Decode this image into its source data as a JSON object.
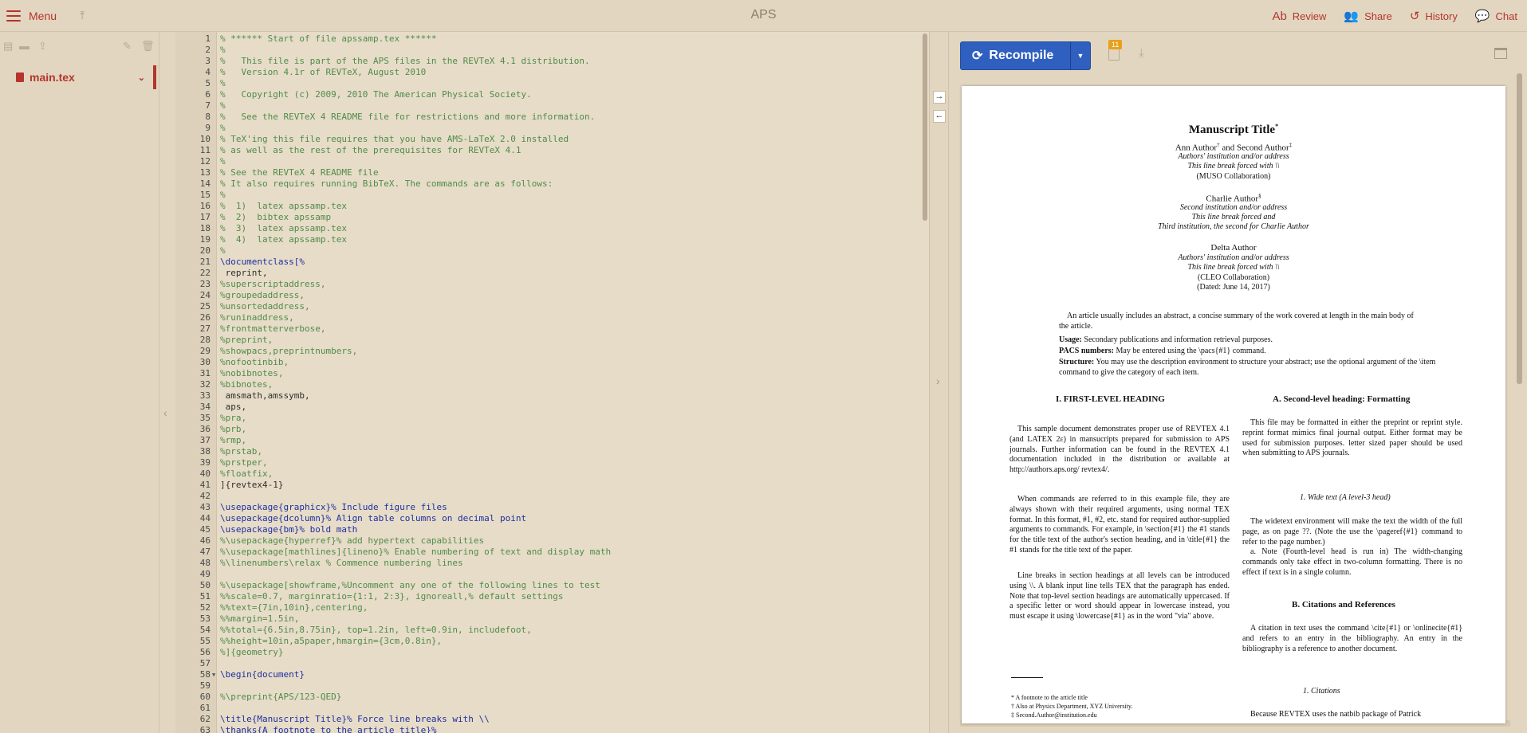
{
  "topbar": {
    "menu_label": "Menu",
    "title": "APS",
    "actions": [
      {
        "label": "Review",
        "icon": "review-icon"
      },
      {
        "label": "Share",
        "icon": "share-icon"
      },
      {
        "label": "History",
        "icon": "history-icon"
      },
      {
        "label": "Chat",
        "icon": "chat-icon"
      }
    ]
  },
  "file_tree": {
    "main_file": "main.tex"
  },
  "colors": {
    "accent": "#b5342d",
    "recompile": "#2f5fbf",
    "badge": "#e8a11b",
    "comment": "#4f8c4a",
    "command": "#1e2fa0"
  },
  "editor": {
    "lines": [
      [
        1,
        "% ****** Start of file apssamp.tex ******",
        "c"
      ],
      [
        2,
        "%",
        "c"
      ],
      [
        3,
        "%   This file is part of the APS files in the REVTeX 4.1 distribution.",
        "c"
      ],
      [
        4,
        "%   Version 4.1r of REVTeX, August 2010",
        "c"
      ],
      [
        5,
        "%",
        "c"
      ],
      [
        6,
        "%   Copyright (c) 2009, 2010 The American Physical Society.",
        "c"
      ],
      [
        7,
        "%",
        "c"
      ],
      [
        8,
        "%   See the REVTeX 4 README file for restrictions and more information.",
        "c"
      ],
      [
        9,
        "%",
        "c"
      ],
      [
        10,
        "% TeX'ing this file requires that you have AMS-LaTeX 2.0 installed",
        "c"
      ],
      [
        11,
        "% as well as the rest of the prerequisites for REVTeX 4.1",
        "c"
      ],
      [
        12,
        "%",
        "c"
      ],
      [
        13,
        "% See the REVTeX 4 README file",
        "c"
      ],
      [
        14,
        "% It also requires running BibTeX. The commands are as follows:",
        "c"
      ],
      [
        15,
        "%",
        "c"
      ],
      [
        16,
        "%  1)  latex apssamp.tex",
        "c"
      ],
      [
        17,
        "%  2)  bibtex apssamp",
        "c"
      ],
      [
        18,
        "%  3)  latex apssamp.tex",
        "c"
      ],
      [
        19,
        "%  4)  latex apssamp.tex",
        "c"
      ],
      [
        20,
        "%",
        "c"
      ],
      [
        21,
        "\\documentclass[%",
        "k"
      ],
      [
        22,
        " reprint,",
        "n"
      ],
      [
        23,
        "%superscriptaddress,",
        "c"
      ],
      [
        24,
        "%groupedaddress,",
        "c"
      ],
      [
        25,
        "%unsortedaddress,",
        "c"
      ],
      [
        26,
        "%runinaddress,",
        "c"
      ],
      [
        27,
        "%frontmatterverbose,",
        "c"
      ],
      [
        28,
        "%preprint,",
        "c"
      ],
      [
        29,
        "%showpacs,preprintnumbers,",
        "c"
      ],
      [
        30,
        "%nofootinbib,",
        "c"
      ],
      [
        31,
        "%nobibnotes,",
        "c"
      ],
      [
        32,
        "%bibnotes,",
        "c"
      ],
      [
        33,
        " amsmath,amssymb,",
        "n"
      ],
      [
        34,
        " aps,",
        "n"
      ],
      [
        35,
        "%pra,",
        "c"
      ],
      [
        36,
        "%prb,",
        "c"
      ],
      [
        37,
        "%rmp,",
        "c"
      ],
      [
        38,
        "%prstab,",
        "c"
      ],
      [
        39,
        "%prstper,",
        "c"
      ],
      [
        40,
        "%floatfix,",
        "c"
      ],
      [
        41,
        "]{revtex4-1}",
        "n"
      ],
      [
        42,
        "",
        "n"
      ],
      [
        43,
        "\\usepackage{graphicx}% Include figure files",
        "k"
      ],
      [
        44,
        "\\usepackage{dcolumn}% Align table columns on decimal point",
        "k"
      ],
      [
        45,
        "\\usepackage{bm}% bold math",
        "k"
      ],
      [
        46,
        "%\\usepackage{hyperref}% add hypertext capabilities",
        "c"
      ],
      [
        47,
        "%\\usepackage[mathlines]{lineno}% Enable numbering of text and display math",
        "c"
      ],
      [
        48,
        "%\\linenumbers\\relax % Commence numbering lines",
        "c"
      ],
      [
        49,
        "",
        "n"
      ],
      [
        50,
        "%\\usepackage[showframe,%Uncomment any one of the following lines to test",
        "c"
      ],
      [
        51,
        "%%scale=0.7, marginratio={1:1, 2:3}, ignoreall,% default settings",
        "c"
      ],
      [
        52,
        "%%text={7in,10in},centering,",
        "c"
      ],
      [
        53,
        "%%margin=1.5in,",
        "c"
      ],
      [
        54,
        "%%total={6.5in,8.75in}, top=1.2in, left=0.9in, includefoot,",
        "c"
      ],
      [
        55,
        "%%height=10in,a5paper,hmargin={3cm,0.8in},",
        "c"
      ],
      [
        56,
        "%]{geometry}",
        "c"
      ],
      [
        57,
        "",
        "n"
      ],
      [
        58,
        "\\begin{document}",
        "k"
      ],
      [
        59,
        "",
        "n"
      ],
      [
        60,
        "%\\preprint{APS/123-QED}",
        "c"
      ],
      [
        61,
        "",
        "n"
      ],
      [
        62,
        "\\title{Manuscript Title}% Force line breaks with \\\\",
        "k"
      ],
      [
        63,
        "\\thanks{A footnote to the article title}%",
        "k"
      ]
    ]
  },
  "pdf": {
    "recompile_label": "Recompile",
    "log_badge": "11",
    "page": {
      "title": "Manuscript Title",
      "title_mark": "*",
      "author_line1": "Ann Author",
      "author_line1_mark": "†",
      "author_line1_and": " and Second Author",
      "author_line1_mark2": "‡",
      "inst1": "Authors' institution and/or address",
      "inst1b": "This line break forced with \\\\",
      "collab1": "(MUSO Collaboration)",
      "author2": "Charlie Author",
      "author2_mark": "§",
      "inst2a": "Second institution and/or address",
      "inst2b": "This line break forced and",
      "inst2c": "Third institution, the second for Charlie Author",
      "author3": "Delta Author",
      "inst3a": "Authors' institution and/or address",
      "inst3b": "This line break forced with \\\\",
      "collab2": "(CLEO Collaboration)",
      "dated": "(Dated: June 14, 2017)",
      "abstract": "An article usually includes an abstract, a concise summary of the work covered at length in the main body of the article.",
      "usage_label": "Usage:",
      "usage_text": " Secondary publications and information retrieval purposes.",
      "pacs_label": "PACS numbers:",
      "pacs_text": " May be entered using the \\pacs{#1} command.",
      "structure_label": "Structure:",
      "structure_text": " You may use the description environment to structure your abstract; use the optional argument of the \\item command to give the category of each item.",
      "sec1_head": "I.   FIRST-LEVEL HEADING",
      "sec1_p1": "This sample document demonstrates proper use of REVTEX 4.1 (and LATEX 2ε) in mansucripts prepared for submission to APS journals. Further information can be found in the REVTEX 4.1 documentation included in the distribution or available at http://authors.aps.org/ revtex4/.",
      "sec1_p2": "When commands are referred to in this example file, they are always shown with their required arguments, using normal TEX format. In this format, #1, #2, etc. stand for required author-supplied arguments to commands. For example, in \\section{#1} the #1 stands for the title text of the author's section heading, and in \\title{#1} the #1 stands for the title text of the paper.",
      "sec1_p3": "Line breaks in section headings at all levels can be introduced using \\\\. A blank input line tells TEX that the paragraph has ended. Note that top-level section headings are automatically uppercased. If a specific letter or word should appear in lowercase instead, you must escape it using \\lowercase{#1} as in the word \"via\" above.",
      "secA_head": "A.   Second-level heading: Formatting",
      "secA_p1": "This file may be formatted in either the preprint or reprint style. reprint format mimics final journal output. Either format may be used for submission purposes. letter sized paper should be used when submitting to APS journals.",
      "sub1_head": "1.   Wide text (A level-3 head)",
      "sub1_p1": "The widetext environment will make the text the width of the full page, as on page ??. (Note the use the \\pageref{#1} command to refer to the page number.)",
      "sub1_p2": "a.   Note (Fourth-level head is run in)  The width-changing commands only take effect in two-column formatting. There is no effect if text is in a single column.",
      "secB_head": "B.   Citations and References",
      "secB_p1": "A citation in text uses the command \\cite{#1} or \\onlinecite{#1} and refers to an entry in the bibliography. An entry in the bibliography is a reference to another document.",
      "sub2_head": "1.   Citations",
      "sub2_p1": "Because REVTEX uses the natbib package of Patrick",
      "fn1": "* A footnote to the article title",
      "fn2": "† Also at Physics Department, XYZ University.",
      "fn3": "‡ Second.Author@institution.edu"
    }
  }
}
